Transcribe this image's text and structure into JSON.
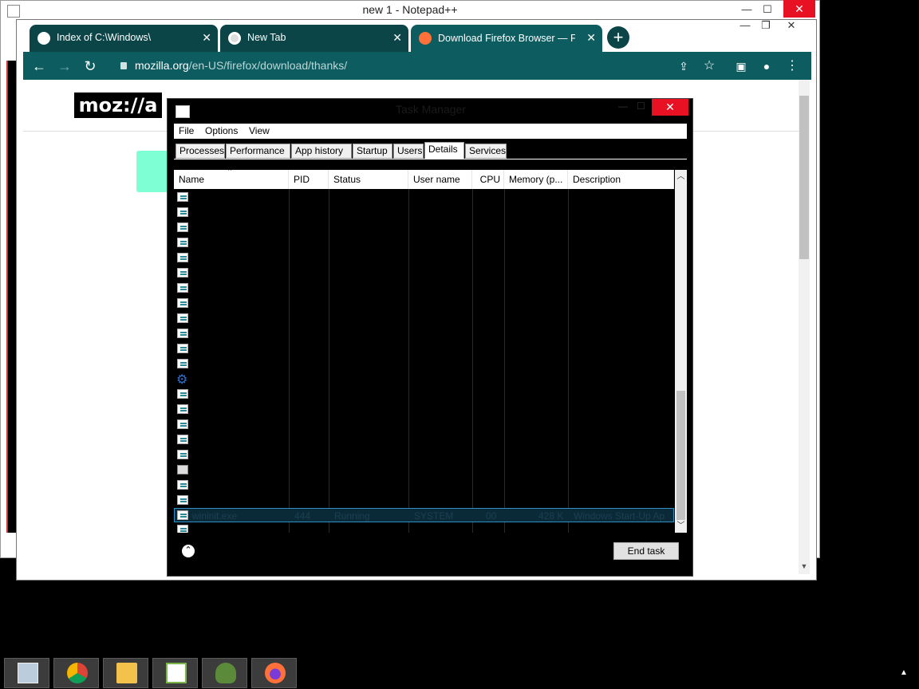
{
  "notepad": {
    "title": "new 1 - Notepad++",
    "minimize": "—",
    "maximize": "☐",
    "close": "✕"
  },
  "chrome": {
    "tabs": [
      {
        "title": "Index of C:\\Windows\\",
        "close": "✕"
      },
      {
        "title": "New Tab",
        "close": "✕"
      },
      {
        "title": "Download Firefox Browser — Fas",
        "close": "✕"
      }
    ],
    "new_tab": "+",
    "window_controls": {
      "minimize": "—",
      "maximize": "❐",
      "close": "✕"
    },
    "nav": {
      "back": "←",
      "forward": "→",
      "reload": "↻"
    },
    "url_host": "mozilla.org",
    "url_path": "/en-US/firefox/download/thanks/",
    "logo_text": "moz://a"
  },
  "task_manager": {
    "title": "Task Manager",
    "close": "✕",
    "menu": [
      "File",
      "Options",
      "View"
    ],
    "tabs": [
      "Processes",
      "Performance",
      "App history",
      "Startup",
      "Users",
      "Details",
      "Services"
    ],
    "selected_tab": "Details",
    "columns": [
      "Name",
      "PID",
      "Status",
      "User name",
      "CPU",
      "Memory (p...",
      "Description"
    ],
    "selected_row": {
      "name": "wininit.exe",
      "pid": "444",
      "status": "Running",
      "user": "SYSTEM",
      "cpu": "00",
      "memory": "428 K",
      "description": "Windows Start-Up Ap"
    },
    "fewer_details": "⌃",
    "end_task": "End task"
  },
  "taskbar": {
    "apps": [
      "task-manager",
      "chrome",
      "file-explorer",
      "notepad-plus-plus",
      "tortoise-app",
      "firefox"
    ],
    "tray_arrow": "▲"
  },
  "colors": {
    "chrome_teal": "#0d5c60",
    "close_red": "#e81123",
    "selection_border": "#2f8fc8"
  }
}
